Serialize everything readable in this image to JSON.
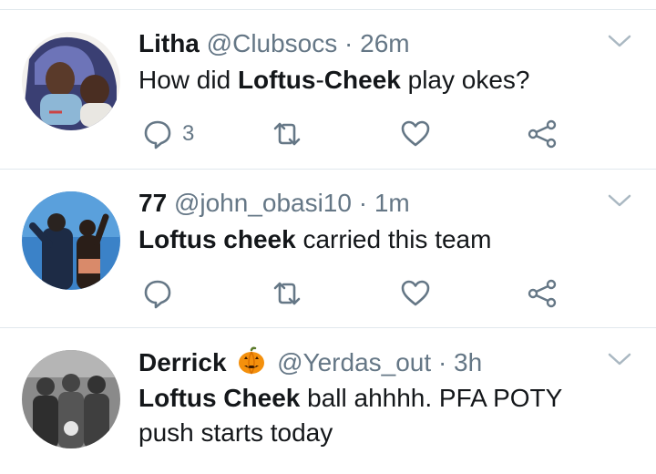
{
  "tweets": [
    {
      "name": "Litha",
      "handle": "@Clubsocs",
      "separator": "·",
      "time": "26m",
      "body": {
        "pre": "How did ",
        "bold": "Loftus",
        "mid": "-",
        "bold2": "Cheek",
        "post": " play okes?"
      },
      "reply_count": "3"
    },
    {
      "name": "77",
      "handle": "@john_obasi10",
      "separator": "·",
      "time": "1m",
      "body": {
        "bold": "Loftus cheek",
        "post": " carried this team"
      },
      "reply_count": ""
    },
    {
      "name": "Derrick",
      "handle": "@Yerdas_out",
      "separator": "·",
      "time": "3h",
      "body": {
        "bold": "Loftus Cheek",
        "post": " ball ahhhh. PFA POTY push starts today"
      },
      "reply_count": ""
    }
  ],
  "colors": {
    "icon": "#657786",
    "divider": "#e1e8ed",
    "text": "#14171a",
    "pumpkin": "#f4900c"
  },
  "icons": [
    "reply-icon",
    "retweet-icon",
    "like-icon",
    "share-icon",
    "chevron-down-icon",
    "jack-o-lantern-icon"
  ]
}
